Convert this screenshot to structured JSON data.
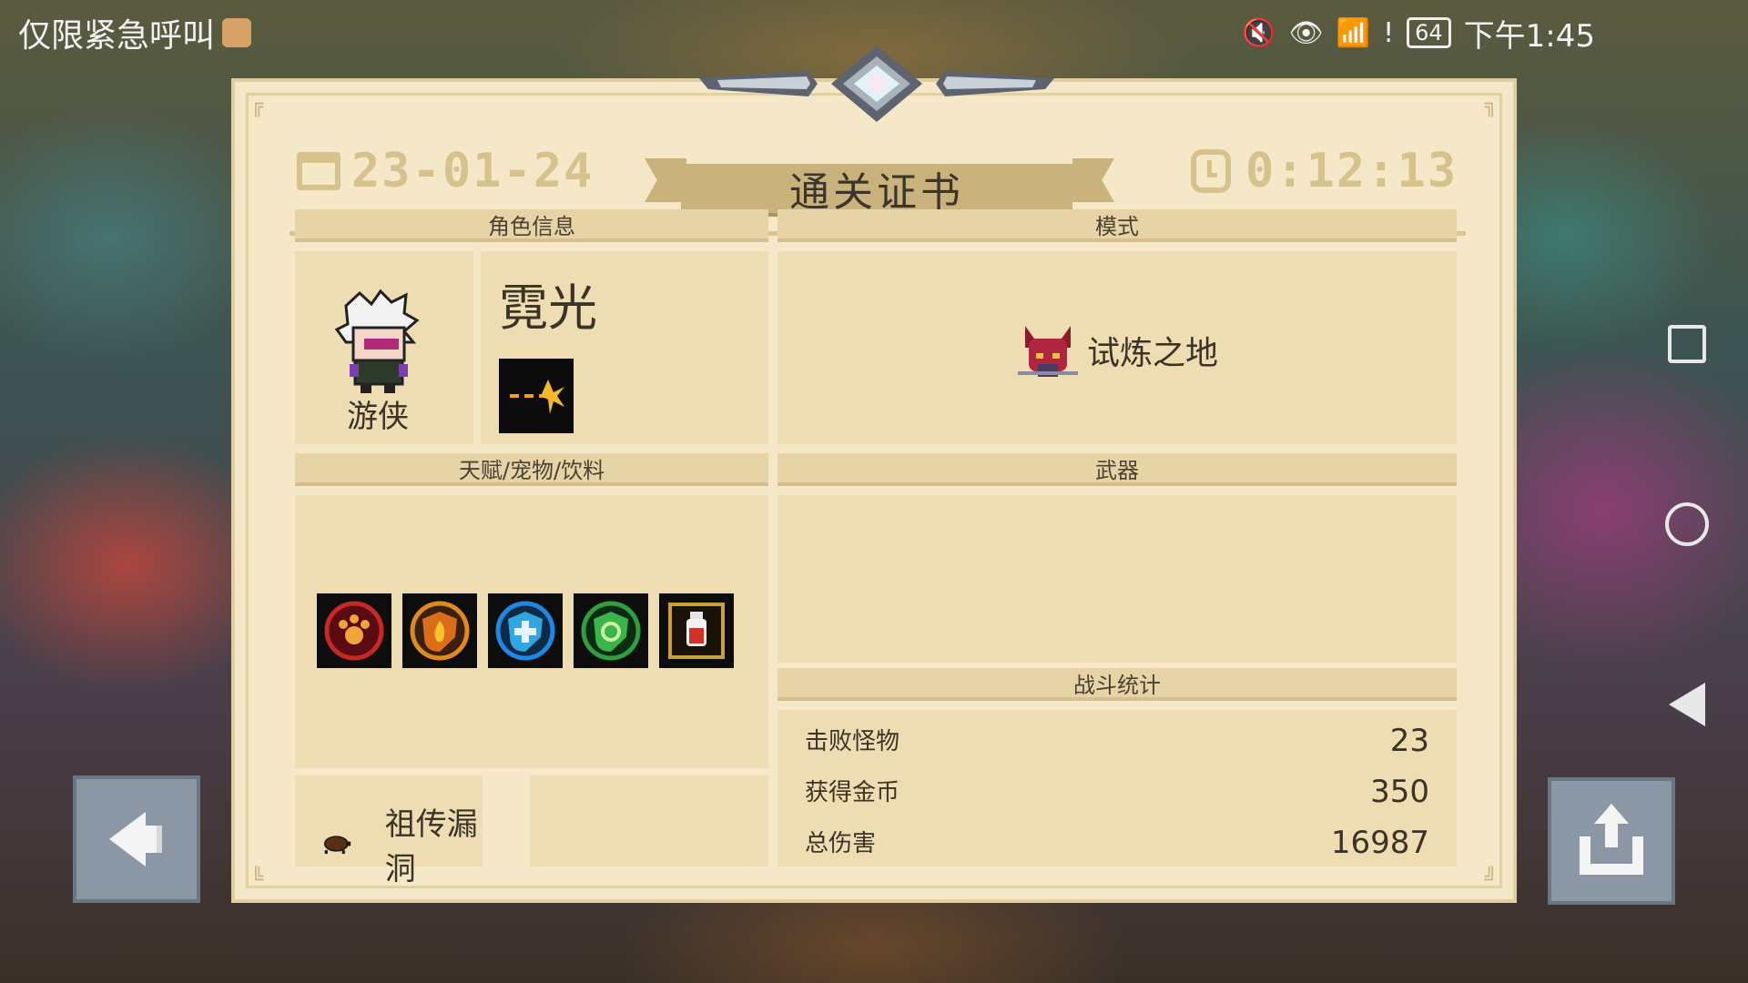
{
  "status_bar": {
    "left_text": "仅限紧急呼叫",
    "battery": "64",
    "time": "下午1:45",
    "icons": [
      "sim-card-icon",
      "mute-icon",
      "eye-icon",
      "wifi-icon",
      "sim-alert-icon",
      "battery-icon"
    ]
  },
  "certificate": {
    "date": "23-01-24",
    "title": "通关证书",
    "elapsed": "0:12:13",
    "sections": {
      "character": "角色信息",
      "mode": "模式",
      "talents": "天赋/宠物/饮料",
      "weapons": "武器",
      "combat": "战斗统计"
    },
    "character": {
      "class_name": "游侠",
      "skin_name": "霓光",
      "skill_icon": "dash-skill-icon"
    },
    "mode": {
      "name": "试炼之地",
      "icon": "demon-mode-icon"
    },
    "talents": [
      {
        "icon": "paw-talent-icon",
        "color": "#c62828"
      },
      {
        "icon": "fire-shield-icon",
        "color": "#e08a1e"
      },
      {
        "icon": "medic-shield-icon",
        "color": "#1e88e5"
      },
      {
        "icon": "green-shield-icon",
        "color": "#2e9e3e"
      },
      {
        "icon": "potion-drink-icon",
        "color": "#c9a03a"
      }
    ],
    "bug": {
      "label": "祖传漏洞",
      "icon": "beetle-icon"
    },
    "combat_stats": [
      {
        "label": "击败怪物",
        "value": "23"
      },
      {
        "label": "获得金币",
        "value": "350"
      },
      {
        "label": "总伤害",
        "value": "16987"
      }
    ]
  },
  "buttons": {
    "back_icon": "back-arrow-icon",
    "share_icon": "share-icon"
  },
  "colors": {
    "paper": "#f5e8c8",
    "section_head": "#e6d4a6",
    "banner": "#c9b27b",
    "header_text": "#d6c28d",
    "button": "#8b97a5"
  }
}
